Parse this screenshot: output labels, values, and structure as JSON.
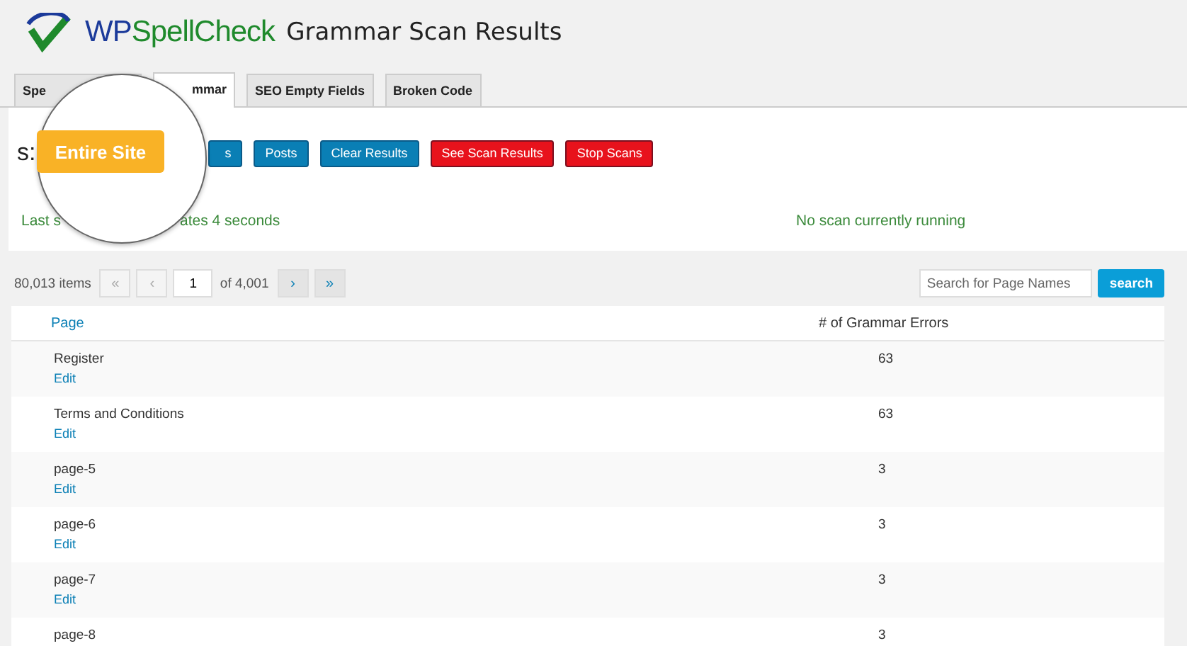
{
  "header": {
    "logo": {
      "prefix": "WP",
      "suffix": "SpellCheck"
    },
    "title": "Grammar Scan Results"
  },
  "tabs": [
    {
      "label": "Spe",
      "selected": false
    },
    {
      "label": "mmar",
      "selected": true
    },
    {
      "label": "SEO Empty Fields",
      "selected": false
    },
    {
      "label": "Broken Code",
      "selected": false
    }
  ],
  "scan_panel": {
    "label": "s:",
    "buttons": [
      {
        "label": "s",
        "kind": "blue"
      },
      {
        "label": "Posts",
        "kind": "blue"
      },
      {
        "label": "Clear Results",
        "kind": "blue"
      },
      {
        "label": "See Scan Results",
        "kind": "red"
      },
      {
        "label": "Stop Scans",
        "kind": "red"
      }
    ],
    "last_scan": [
      "Last s",
      "ates 4 seconds"
    ],
    "status": "No scan currently running"
  },
  "magnifier": {
    "button": "Entire Site"
  },
  "pagination": {
    "items": "80,013 items",
    "first": "«",
    "prev": "‹",
    "page": "1",
    "of": "of 4,001",
    "next": "›",
    "last": "»"
  },
  "search": {
    "placeholder": "Search for Page Names",
    "button": "search"
  },
  "table": {
    "columns": [
      "Page",
      "# of Grammar Errors"
    ],
    "rows": [
      {
        "page": "Register",
        "edit": "Edit",
        "errors": "63"
      },
      {
        "page": "Terms and Conditions",
        "edit": "Edit",
        "errors": "63"
      },
      {
        "page": "page-5",
        "edit": "Edit",
        "errors": "3"
      },
      {
        "page": "page-6",
        "edit": "Edit",
        "errors": "3"
      },
      {
        "page": "page-7",
        "edit": "Edit",
        "errors": "3"
      },
      {
        "page": "page-8",
        "errors": "3"
      }
    ]
  }
}
